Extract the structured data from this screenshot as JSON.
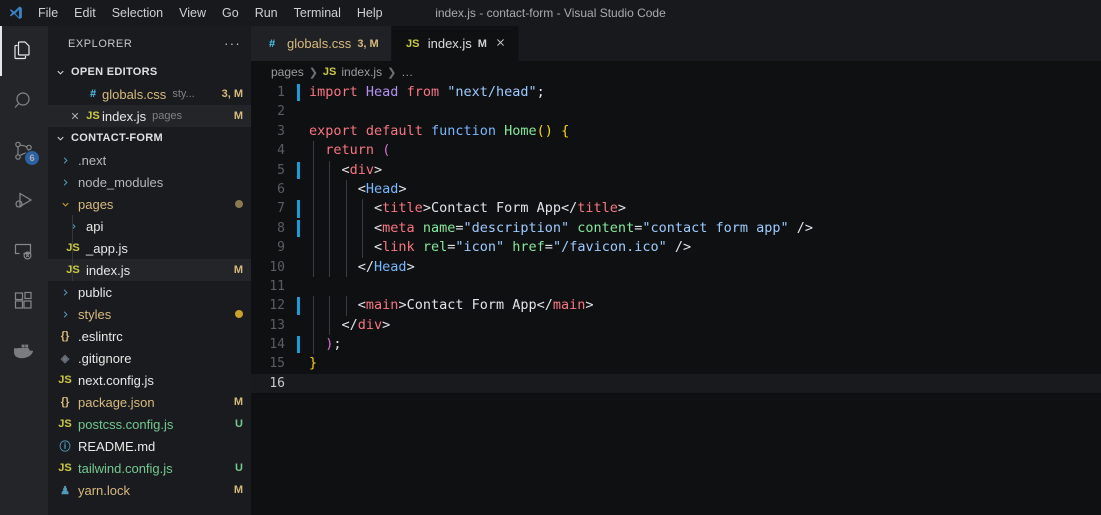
{
  "titlebar": {
    "window_title": "index.js - contact-form - Visual Studio Code",
    "logo_icon": "vscode-logo-icon",
    "menus": [
      "File",
      "Edit",
      "Selection",
      "View",
      "Go",
      "Run",
      "Terminal",
      "Help"
    ]
  },
  "activitybar": {
    "items": [
      {
        "name": "explorer",
        "icon": "files-icon",
        "active": true,
        "badge": ""
      },
      {
        "name": "search",
        "icon": "search-icon",
        "active": false,
        "badge": ""
      },
      {
        "name": "source-control",
        "icon": "source-control-icon",
        "active": false,
        "badge": "6"
      },
      {
        "name": "run-and-debug",
        "icon": "run-debug-icon",
        "active": false,
        "badge": ""
      },
      {
        "name": "remote-explorer",
        "icon": "remote-icon",
        "active": false,
        "badge": ""
      },
      {
        "name": "extensions",
        "icon": "extensions-icon",
        "active": false,
        "badge": ""
      },
      {
        "name": "docker",
        "icon": "docker-icon",
        "active": false,
        "badge": ""
      }
    ]
  },
  "sidebar": {
    "title": "EXPLORER",
    "more_actions": "···",
    "open_editors": {
      "label": "OPEN EDITORS",
      "items": [
        {
          "name": "globals.css",
          "icon": "#",
          "icon_color": "#4ec9f5",
          "label_color": "#d7ba7d",
          "sub": "sty...",
          "mark": "3, M",
          "mark_color": "#d7ba7d",
          "selected": false,
          "closable": false
        },
        {
          "name": "index.js",
          "icon": "JS",
          "icon_color": "#cbcb41",
          "label_color": "#e8e8e8",
          "sub": "pages",
          "mark": "M",
          "mark_color": "#d7ba7d",
          "selected": true,
          "closable": true
        }
      ]
    },
    "project": {
      "label": "CONTACT-FORM",
      "items": [
        {
          "name": ".next",
          "type": "folder",
          "expanded": false,
          "depth": 1,
          "label_color": "#b6b7b8",
          "mark": "",
          "dot": ""
        },
        {
          "name": "node_modules",
          "type": "folder",
          "expanded": false,
          "depth": 1,
          "label_color": "#b6b7b8",
          "mark": "",
          "dot": ""
        },
        {
          "name": "pages",
          "type": "folder",
          "expanded": true,
          "depth": 1,
          "label_color": "#d7ba7d",
          "mark": "",
          "dot": "#8a7a52"
        },
        {
          "name": "api",
          "type": "folder",
          "expanded": false,
          "depth": 2,
          "label_color": "#e8e8e8",
          "mark": "",
          "dot": ""
        },
        {
          "name": "_app.js",
          "type": "js",
          "icon": "JS",
          "icon_color": "#cbcb41",
          "depth": 2,
          "label_color": "#e8e8e8",
          "mark": "",
          "dot": ""
        },
        {
          "name": "index.js",
          "type": "js",
          "icon": "JS",
          "icon_color": "#cbcb41",
          "depth": 2,
          "label_color": "#e8e8e8",
          "mark": "M",
          "mark_color": "#d7ba7d",
          "dot": "",
          "selected": true
        },
        {
          "name": "public",
          "type": "folder",
          "expanded": false,
          "depth": 1,
          "label_color": "#e8e8e8",
          "mark": "",
          "dot": ""
        },
        {
          "name": "styles",
          "type": "folder",
          "expanded": false,
          "depth": 1,
          "label_color": "#d7ba7d",
          "mark": "",
          "dot": "#c8a22a"
        },
        {
          "name": ".eslintrc",
          "type": "json",
          "icon": "{}",
          "icon_color": "#d7ba7d",
          "depth": 1,
          "label_color": "#e8e8e8",
          "mark": "",
          "dot": ""
        },
        {
          "name": ".gitignore",
          "type": "git",
          "icon": "◈",
          "icon_color": "#6a737d",
          "depth": 1,
          "label_color": "#e8e8e8",
          "mark": "",
          "dot": ""
        },
        {
          "name": "next.config.js",
          "type": "js",
          "icon": "JS",
          "icon_color": "#cbcb41",
          "depth": 1,
          "label_color": "#e8e8e8",
          "mark": "",
          "dot": ""
        },
        {
          "name": "package.json",
          "type": "json",
          "icon": "{}",
          "icon_color": "#d7ba7d",
          "depth": 1,
          "label_color": "#d7ba7d",
          "mark": "M",
          "mark_color": "#d7ba7d",
          "dot": ""
        },
        {
          "name": "postcss.config.js",
          "type": "js",
          "icon": "JS",
          "icon_color": "#cbcb41",
          "depth": 1,
          "label_color": "#73c991",
          "mark": "U",
          "mark_color": "#73c991",
          "dot": ""
        },
        {
          "name": "README.md",
          "type": "md",
          "icon": "ⓘ",
          "icon_color": "#519aba",
          "depth": 1,
          "label_color": "#e8e8e8",
          "mark": "",
          "dot": ""
        },
        {
          "name": "tailwind.config.js",
          "type": "js",
          "icon": "JS",
          "icon_color": "#cbcb41",
          "depth": 1,
          "label_color": "#73c991",
          "mark": "U",
          "mark_color": "#73c991",
          "dot": ""
        },
        {
          "name": "yarn.lock",
          "type": "yarn",
          "icon": "♟",
          "icon_color": "#519aba",
          "depth": 1,
          "label_color": "#d7ba7d",
          "mark": "M",
          "mark_color": "#d7ba7d",
          "dot": ""
        }
      ]
    }
  },
  "editor": {
    "tabs": [
      {
        "label": "globals.css",
        "icon": "#",
        "icon_color": "#4ec9f5",
        "label_color": "#d7ba7d",
        "mark": "3, M",
        "mark_color": "#d7ba7d",
        "active": false,
        "closable": false
      },
      {
        "label": "index.js",
        "icon": "JS",
        "icon_color": "#cbcb41",
        "label_color": "#dcdcdc",
        "mark": "M",
        "mark_color": "#cfd0d1",
        "active": true,
        "closable": true,
        "close_icon": "close-icon"
      }
    ],
    "breadcrumb": [
      "pages",
      "index.js",
      "…"
    ],
    "breadcrumb_icon": "JS",
    "active_line": 16,
    "lines": [
      {
        "n": 1,
        "changed": true,
        "indent": 0,
        "tokens": [
          {
            "t": "import",
            "c": "t-kw"
          },
          {
            "t": " ",
            "c": "t-pl"
          },
          {
            "t": "Head",
            "c": "t-name"
          },
          {
            "t": " ",
            "c": "t-pl"
          },
          {
            "t": "from",
            "c": "t-kw"
          },
          {
            "t": " ",
            "c": "t-pl"
          },
          {
            "t": "\"next/head\"",
            "c": "t-str"
          },
          {
            "t": ";",
            "c": "t-punc"
          }
        ]
      },
      {
        "n": 2,
        "changed": false,
        "indent": 0,
        "tokens": []
      },
      {
        "n": 3,
        "changed": false,
        "indent": 0,
        "tokens": [
          {
            "t": "export",
            "c": "t-kw"
          },
          {
            "t": " ",
            "c": "t-pl"
          },
          {
            "t": "default",
            "c": "t-kw"
          },
          {
            "t": " ",
            "c": "t-pl"
          },
          {
            "t": "function",
            "c": "t-fn"
          },
          {
            "t": " ",
            "c": "t-pl"
          },
          {
            "t": "Home",
            "c": "t-tag"
          },
          {
            "t": "()",
            "c": "t-brk"
          },
          {
            "t": " ",
            "c": "t-pl"
          },
          {
            "t": "{",
            "c": "t-brk"
          }
        ]
      },
      {
        "n": 4,
        "changed": false,
        "indent": 1,
        "tokens": [
          {
            "t": "  ",
            "c": "t-pl"
          },
          {
            "t": "return",
            "c": "t-kw"
          },
          {
            "t": " ",
            "c": "t-pl"
          },
          {
            "t": "(",
            "c": "t-brk2"
          }
        ]
      },
      {
        "n": 5,
        "changed": true,
        "indent": 2,
        "tokens": [
          {
            "t": "    ",
            "c": "t-pl"
          },
          {
            "t": "<",
            "c": "t-punc"
          },
          {
            "t": "div",
            "c": "t-tagr"
          },
          {
            "t": ">",
            "c": "t-punc"
          }
        ]
      },
      {
        "n": 6,
        "changed": false,
        "indent": 3,
        "tokens": [
          {
            "t": "      ",
            "c": "t-pl"
          },
          {
            "t": "<",
            "c": "t-punc"
          },
          {
            "t": "Head",
            "c": "t-fn"
          },
          {
            "t": ">",
            "c": "t-punc"
          }
        ]
      },
      {
        "n": 7,
        "changed": true,
        "indent": 4,
        "tokens": [
          {
            "t": "        ",
            "c": "t-pl"
          },
          {
            "t": "<",
            "c": "t-punc"
          },
          {
            "t": "title",
            "c": "t-tagr"
          },
          {
            "t": ">",
            "c": "t-punc"
          },
          {
            "t": "Contact Form App",
            "c": "t-pl"
          },
          {
            "t": "</",
            "c": "t-punc"
          },
          {
            "t": "title",
            "c": "t-tagr"
          },
          {
            "t": ">",
            "c": "t-punc"
          }
        ]
      },
      {
        "n": 8,
        "changed": true,
        "indent": 4,
        "tokens": [
          {
            "t": "        ",
            "c": "t-pl"
          },
          {
            "t": "<",
            "c": "t-punc"
          },
          {
            "t": "meta",
            "c": "t-tagr"
          },
          {
            "t": " ",
            "c": "t-pl"
          },
          {
            "t": "name",
            "c": "t-tag"
          },
          {
            "t": "=",
            "c": "t-punc"
          },
          {
            "t": "\"description\"",
            "c": "t-attrv"
          },
          {
            "t": " ",
            "c": "t-pl"
          },
          {
            "t": "content",
            "c": "t-tag"
          },
          {
            "t": "=",
            "c": "t-punc"
          },
          {
            "t": "\"contact form app\"",
            "c": "t-attrv"
          },
          {
            "t": " ",
            "c": "t-pl"
          },
          {
            "t": "/>",
            "c": "t-punc"
          }
        ]
      },
      {
        "n": 9,
        "changed": false,
        "indent": 4,
        "tokens": [
          {
            "t": "        ",
            "c": "t-pl"
          },
          {
            "t": "<",
            "c": "t-punc"
          },
          {
            "t": "link",
            "c": "t-tagr"
          },
          {
            "t": " ",
            "c": "t-pl"
          },
          {
            "t": "rel",
            "c": "t-tag"
          },
          {
            "t": "=",
            "c": "t-punc"
          },
          {
            "t": "\"icon\"",
            "c": "t-attrv"
          },
          {
            "t": " ",
            "c": "t-pl"
          },
          {
            "t": "href",
            "c": "t-tag"
          },
          {
            "t": "=",
            "c": "t-punc"
          },
          {
            "t": "\"/favicon.ico\"",
            "c": "t-attrv"
          },
          {
            "t": " ",
            "c": "t-pl"
          },
          {
            "t": "/>",
            "c": "t-punc"
          }
        ]
      },
      {
        "n": 10,
        "changed": false,
        "indent": 3,
        "tokens": [
          {
            "t": "      ",
            "c": "t-pl"
          },
          {
            "t": "</",
            "c": "t-punc"
          },
          {
            "t": "Head",
            "c": "t-fn"
          },
          {
            "t": ">",
            "c": "t-punc"
          }
        ]
      },
      {
        "n": 11,
        "changed": false,
        "indent": 3,
        "tokens": []
      },
      {
        "n": 12,
        "changed": true,
        "indent": 3,
        "tokens": [
          {
            "t": "      ",
            "c": "t-pl"
          },
          {
            "t": "<",
            "c": "t-punc"
          },
          {
            "t": "main",
            "c": "t-tagr"
          },
          {
            "t": ">",
            "c": "t-punc"
          },
          {
            "t": "Contact Form App",
            "c": "t-pl"
          },
          {
            "t": "</",
            "c": "t-punc"
          },
          {
            "t": "main",
            "c": "t-tagr"
          },
          {
            "t": ">",
            "c": "t-punc"
          }
        ]
      },
      {
        "n": 13,
        "changed": false,
        "indent": 2,
        "tokens": [
          {
            "t": "    ",
            "c": "t-pl"
          },
          {
            "t": "</",
            "c": "t-punc"
          },
          {
            "t": "div",
            "c": "t-tagr"
          },
          {
            "t": ">",
            "c": "t-punc"
          }
        ]
      },
      {
        "n": 14,
        "changed": true,
        "indent": 1,
        "tokens": [
          {
            "t": "  ",
            "c": "t-pl"
          },
          {
            "t": ")",
            "c": "t-brk2"
          },
          {
            "t": ";",
            "c": "t-punc"
          }
        ]
      },
      {
        "n": 15,
        "changed": false,
        "indent": 0,
        "tokens": [
          {
            "t": "}",
            "c": "t-brk"
          }
        ]
      },
      {
        "n": 16,
        "changed": false,
        "indent": 0,
        "tokens": []
      }
    ]
  }
}
